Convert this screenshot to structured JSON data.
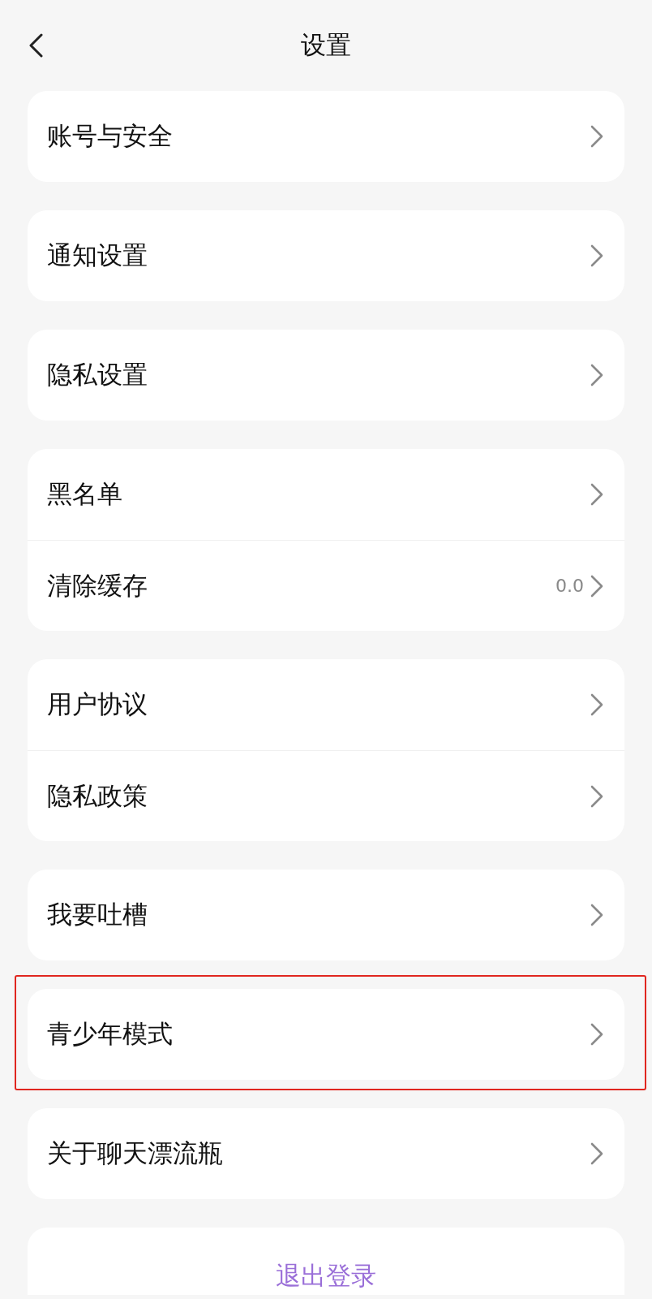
{
  "header": {
    "title": "设置"
  },
  "groups": [
    {
      "items": [
        {
          "label": "账号与安全",
          "highlighted": false
        }
      ]
    },
    {
      "items": [
        {
          "label": "通知设置",
          "highlighted": false
        }
      ]
    },
    {
      "items": [
        {
          "label": "隐私设置",
          "highlighted": false
        }
      ]
    },
    {
      "items": [
        {
          "label": "黑名单",
          "highlighted": false
        },
        {
          "label": "清除缓存",
          "value": "0.0",
          "highlighted": false
        }
      ]
    },
    {
      "items": [
        {
          "label": "用户协议",
          "highlighted": false
        },
        {
          "label": "隐私政策",
          "highlighted": false
        }
      ]
    },
    {
      "items": [
        {
          "label": "我要吐槽",
          "highlighted": false
        }
      ]
    },
    {
      "items": [
        {
          "label": "青少年模式",
          "highlighted": true
        }
      ]
    },
    {
      "items": [
        {
          "label": "关于聊天漂流瓶",
          "highlighted": false
        }
      ]
    }
  ],
  "logout": {
    "label": "退出登录"
  }
}
